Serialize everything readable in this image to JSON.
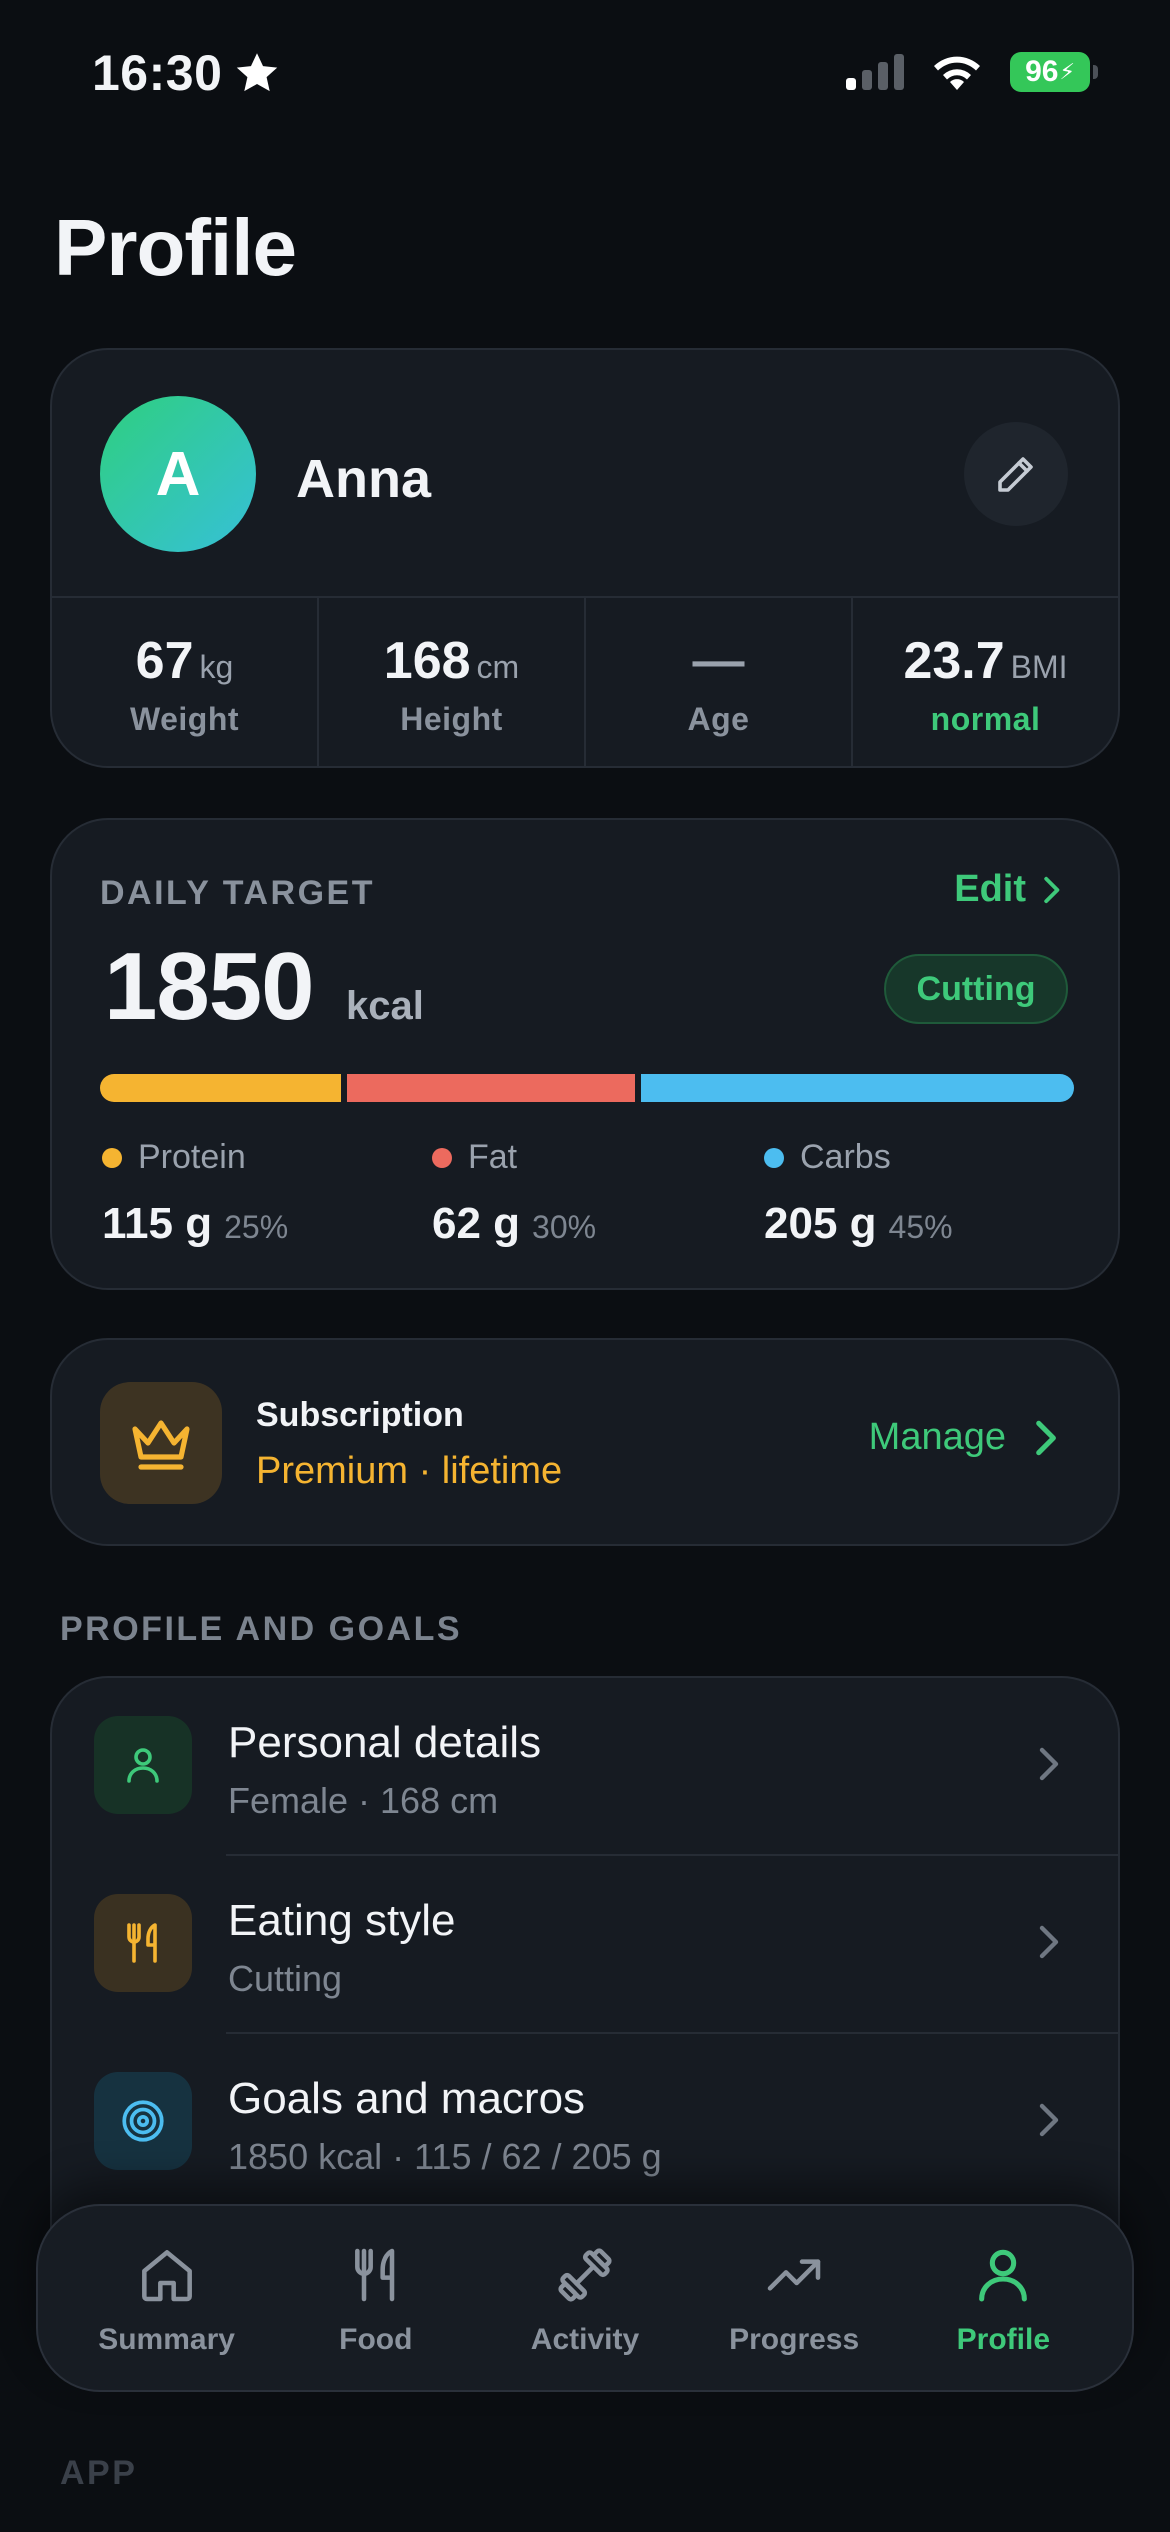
{
  "status_bar": {
    "time": "16:30",
    "battery": "96"
  },
  "page": {
    "title": "Profile"
  },
  "profile": {
    "avatar_initial": "A",
    "name": "Anna",
    "stats": [
      {
        "value": "67",
        "unit": "kg",
        "label": "Weight"
      },
      {
        "value": "168",
        "unit": "cm",
        "label": "Height"
      },
      {
        "value": "—",
        "unit": "",
        "label": "Age"
      },
      {
        "value": "23.7",
        "unit": "BMI",
        "label": "normal"
      }
    ]
  },
  "daily_target": {
    "label": "DAILY TARGET",
    "edit_label": "Edit",
    "kcal": "1850",
    "kcal_unit": "kcal",
    "mode_badge": "Cutting",
    "macros": [
      {
        "name": "Protein",
        "amount": "115 g",
        "percent": "25%",
        "share": 0.25,
        "color": "#f5b431"
      },
      {
        "name": "Fat",
        "amount": "62 g",
        "percent": "30%",
        "share": 0.3,
        "color": "#ec6a5e"
      },
      {
        "name": "Carbs",
        "amount": "205 g",
        "percent": "45%",
        "share": 0.45,
        "color": "#4cbdf0"
      }
    ]
  },
  "subscription": {
    "title": "Subscription",
    "plan": "Premium · lifetime",
    "manage_label": "Manage"
  },
  "section_profile": "PROFILE AND GOALS",
  "settings_rows": [
    {
      "title": "Personal details",
      "subtitle": "Female · 168 cm",
      "icon": "person-icon"
    },
    {
      "title": "Eating style",
      "subtitle": "Cutting",
      "icon": "fork-knife-icon"
    },
    {
      "title": "Goals and macros",
      "subtitle": "1850 kcal · 115 / 62 / 205 g",
      "icon": "target-icon"
    }
  ],
  "section_app": "APP",
  "tabs": [
    {
      "label": "Summary",
      "icon": "home-icon",
      "active": false
    },
    {
      "label": "Food",
      "icon": "fork-knife-icon",
      "active": false
    },
    {
      "label": "Activity",
      "icon": "dumbbell-icon",
      "active": false
    },
    {
      "label": "Progress",
      "icon": "trend-icon",
      "active": false
    },
    {
      "label": "Profile",
      "icon": "person-icon",
      "active": true
    }
  ],
  "colors": {
    "accent": "#3ec97a",
    "background": "#0b0e12",
    "card": "#161b22",
    "premium": "#f5b431"
  }
}
